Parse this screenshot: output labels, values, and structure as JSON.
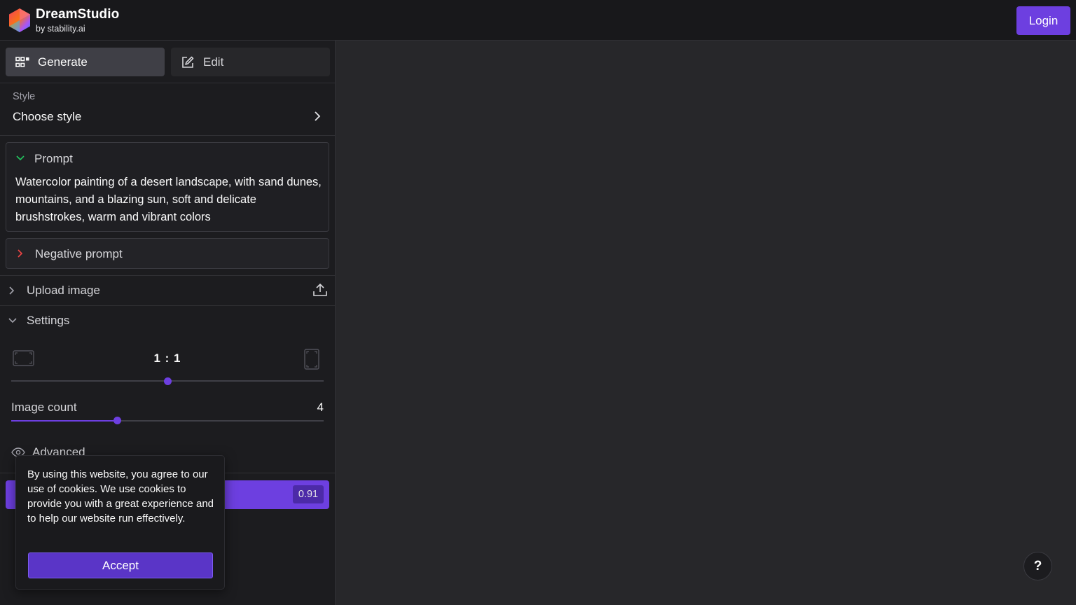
{
  "header": {
    "brand_title": "DreamStudio",
    "brand_subtitle": "by stability.ai",
    "login_label": "Login",
    "logo_icon": "hexagon-gradient-logo"
  },
  "tabs": [
    {
      "label": "Generate",
      "icon": "grid-icon",
      "active": true
    },
    {
      "label": "Edit",
      "icon": "edit-icon",
      "active": false
    }
  ],
  "style": {
    "label": "Style",
    "value": "Choose style",
    "icon": "chevron-right-icon"
  },
  "prompt": {
    "label": "Prompt",
    "text": "Watercolor painting of a desert landscape, with sand dunes, mountains, and a blazing sun, soft and delicate brushstrokes, warm and vibrant colors",
    "expanded": true
  },
  "negative_prompt": {
    "label": "Negative prompt",
    "expanded": false
  },
  "upload": {
    "label": "Upload image",
    "icon": "upload-icon"
  },
  "settings": {
    "label": "Settings",
    "aspect_ratio": "1 : 1",
    "aspect_position": 0.5,
    "image_count_label": "Image count",
    "image_count": "4",
    "image_count_position": 0.34,
    "advanced_label": "Advanced"
  },
  "dream": {
    "cost": "0.91"
  },
  "cookie": {
    "text": "By using this website, you agree to our use of cookies. We use cookies to provide you with a great experience and to help our website run effectively.",
    "accept_label": "Accept"
  },
  "help": {
    "label": "?"
  },
  "colors": {
    "accent": "#6d3fe0",
    "background": "#27272a",
    "sidebar": "#1c1c1f",
    "topbar": "#18181b"
  }
}
